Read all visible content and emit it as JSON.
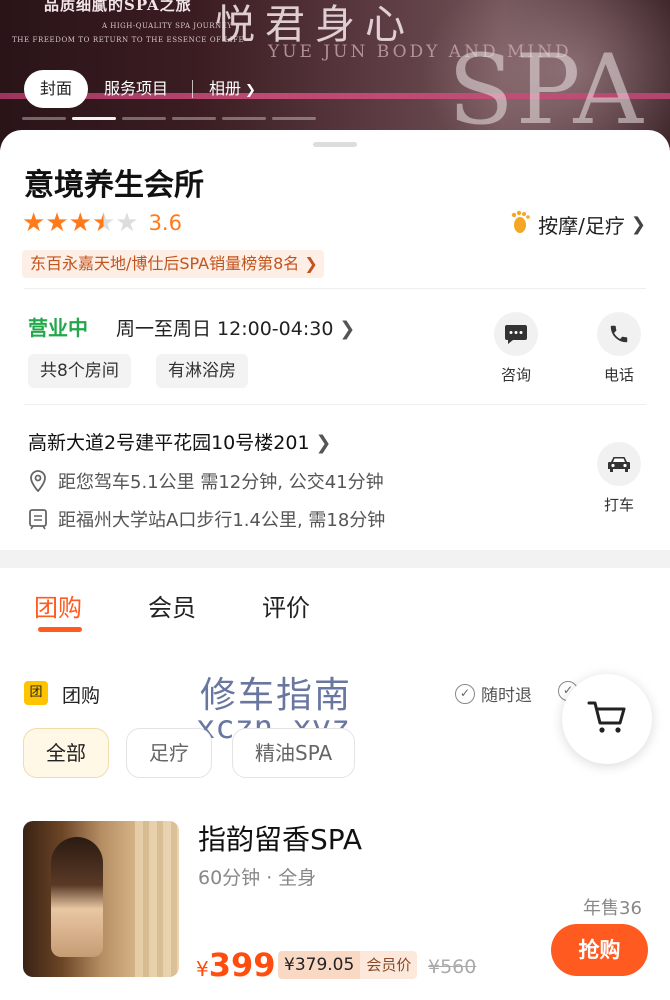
{
  "hero": {
    "tagline_cn": "品质细腻的SPA之旅",
    "tagline_en1": "A HIGH-QUALITY SPA JOURNEY",
    "tagline_en2": "THE FREEDOM TO RETURN TO THE ESSENCE OF LIFE",
    "brand_cn": "悦君身心",
    "brand_en": "YUE JUN BODY AND MIND",
    "brand_spa": "SPA",
    "tabs": [
      {
        "label": "封面",
        "active": true
      },
      {
        "label": "服务项目",
        "active": false
      },
      {
        "label": "相册",
        "active": false
      }
    ],
    "carousel_dots": 6,
    "carousel_active_index": 1
  },
  "shop": {
    "name": "意境养生会所",
    "rating": 3.6,
    "rating_text": "3.6",
    "category": "按摩/足疗",
    "rank": "东百永嘉天地/博仕后SPA销量榜第8名",
    "status": "营业中",
    "hours": "周一至周日 12:00-04:30",
    "features": [
      "共8个房间",
      "有淋浴房"
    ],
    "actions": [
      {
        "label": "咨询",
        "icon": "chat-icon"
      },
      {
        "label": "电话",
        "icon": "phone-icon"
      },
      {
        "label": "打车",
        "icon": "car-icon"
      }
    ],
    "address": "高新大道2号建平花园10号楼201",
    "drive_info": "距您驾车5.1公里 需12分钟, 公交41分钟",
    "metro_info": "距福州大学站A口步行1.4公里, 需18分钟"
  },
  "main_tabs": [
    {
      "label": "团购",
      "active": true
    },
    {
      "label": "会员",
      "active": false
    },
    {
      "label": "评价",
      "active": false
    }
  ],
  "group_buy": {
    "badge": "团",
    "title": "团购",
    "assurances": [
      "随时退"
    ],
    "filters": [
      {
        "label": "全部",
        "active": true
      },
      {
        "label": "足疗",
        "active": false
      },
      {
        "label": "精油SPA",
        "active": false
      }
    ]
  },
  "watermark": {
    "cn": "修车指南",
    "en": "xczn.xyz"
  },
  "deal": {
    "title": "指韵留香SPA",
    "subtitle": "60分钟 · 全身",
    "sold": "年售36",
    "currency": "¥",
    "price": "399",
    "member_price": "¥379.05",
    "member_label": "会员价",
    "original_price": "¥560",
    "buy_label": "抢购"
  },
  "colors": {
    "accent": "#ff5a1f",
    "star": "#ff7a1a",
    "open_status": "#22a84a",
    "rank_bg": "#fdeee6"
  }
}
